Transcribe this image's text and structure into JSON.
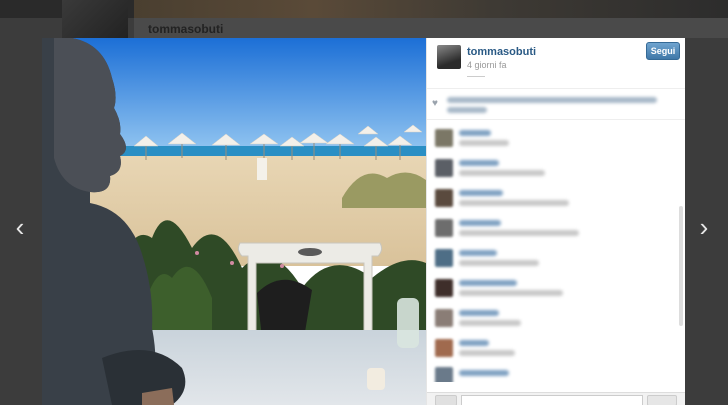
{
  "background": {
    "username": "tommasobuti"
  },
  "post": {
    "owner": "tommasobuti",
    "time_ago": "4 giorni fa",
    "follow_label": "Segui"
  },
  "navigation": {
    "prev_icon": "chevron-left-icon",
    "next_icon": "chevron-right-icon"
  },
  "colors": {
    "link": "#2a5a85",
    "follow_button": "#3f78a8"
  }
}
